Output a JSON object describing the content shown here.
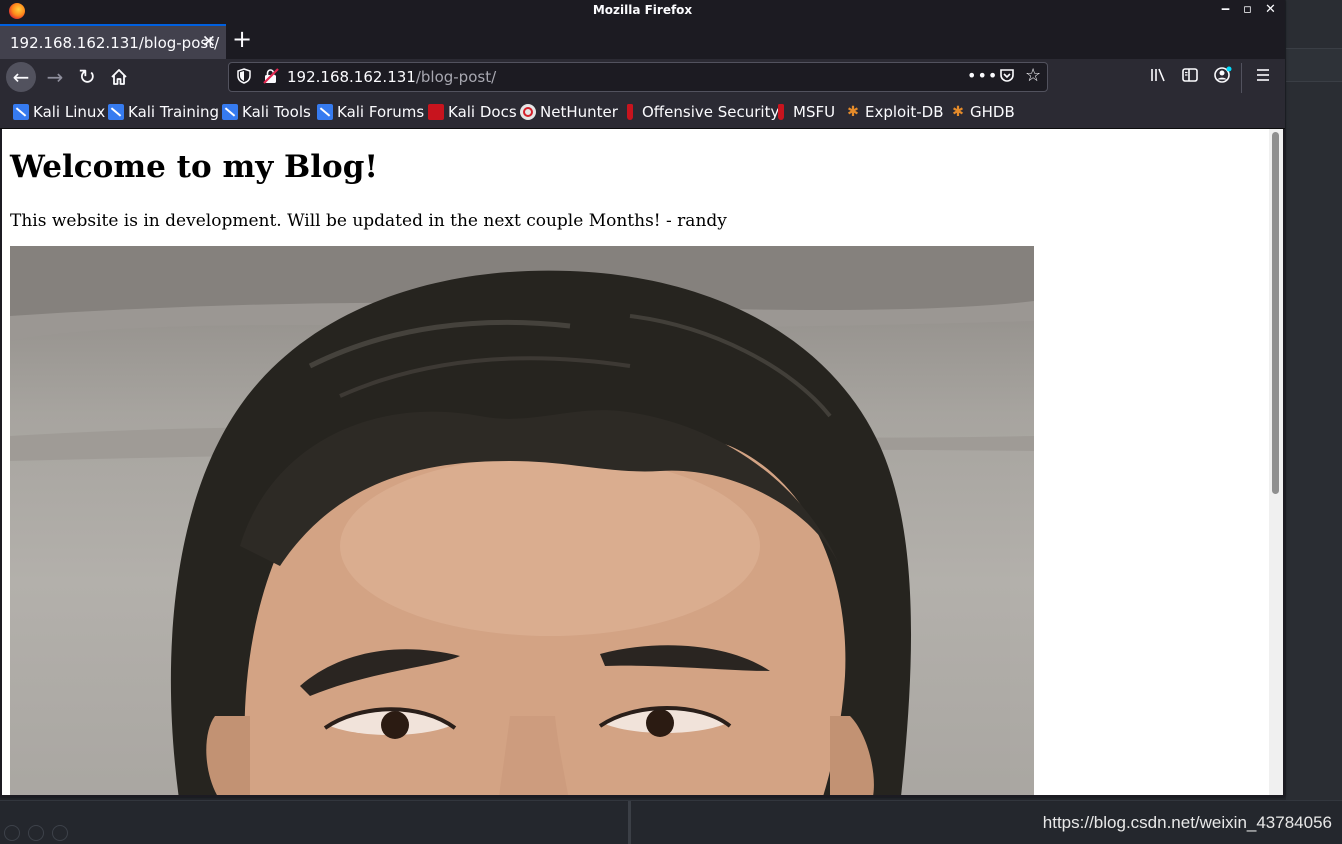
{
  "window": {
    "title": "Mozilla Firefox",
    "controls": {
      "minimize": "‒",
      "maximize": "▫",
      "close": "✕"
    }
  },
  "tab": {
    "title": "192.168.162.131/blog-post/",
    "close": "✕",
    "new_tab": "+"
  },
  "navbar": {
    "url_host": "192.168.162.131",
    "url_path": "/blog-post/",
    "icons": [
      "back-icon",
      "forward-icon",
      "reload-icon",
      "home-icon",
      "tracking-shield-icon",
      "insecure-lock-icon",
      "page-actions-icon",
      "pocket-icon",
      "bookmark-star-icon",
      "library-icon",
      "sidebar-icon",
      "account-icon",
      "menu-icon"
    ]
  },
  "bookmarks": [
    {
      "label": "Kali Linux",
      "icon": "kali-icon"
    },
    {
      "label": "Kali Training",
      "icon": "kali-icon"
    },
    {
      "label": "Kali Tools",
      "icon": "kali-icon"
    },
    {
      "label": "Kali Forums",
      "icon": "kali-icon"
    },
    {
      "label": "Kali Docs",
      "icon": "kali-docs-icon"
    },
    {
      "label": "NetHunter",
      "icon": "nethunter-icon"
    },
    {
      "label": "Offensive Security",
      "icon": "offsec-icon"
    },
    {
      "label": "MSFU",
      "icon": "offsec-icon"
    },
    {
      "label": "Exploit-DB",
      "icon": "exploit-db-icon"
    },
    {
      "label": "GHDB",
      "icon": "exploit-db-icon"
    }
  ],
  "page": {
    "heading": "Welcome to my Blog!",
    "text": "This website is in development. Will be updated in the next couple Months! - randy"
  },
  "watermark": "https://blog.csdn.net/weixin_43784056",
  "colors": {
    "accent": "#0060df",
    "toolbar": "#2b2a33",
    "titlebar": "#1c1b22"
  }
}
